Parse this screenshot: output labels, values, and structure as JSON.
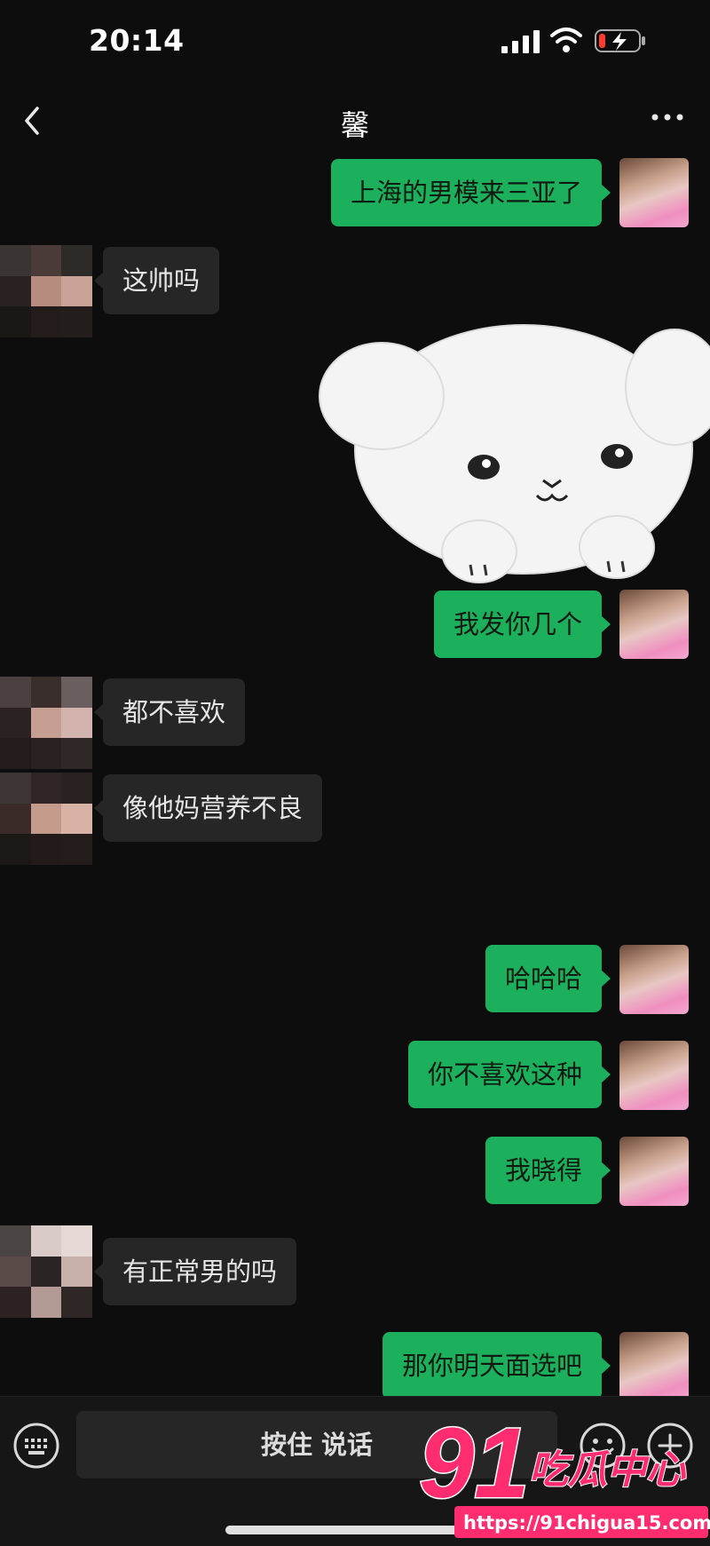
{
  "status_bar": {
    "time": "20:14"
  },
  "header": {
    "title": "馨"
  },
  "messages": [
    {
      "side": "right",
      "text": "上海的男模来三亚了"
    },
    {
      "side": "left",
      "text": "这帅吗"
    },
    {
      "side": "right",
      "type": "sticker",
      "sticker": "fluffy-white-puppy"
    },
    {
      "side": "right",
      "text": "我发你几个"
    },
    {
      "side": "left",
      "text": "都不喜欢"
    },
    {
      "side": "left",
      "text": "像他妈营养不良"
    },
    {
      "side": "right",
      "text": "哈哈哈"
    },
    {
      "side": "right",
      "text": "你不喜欢这种"
    },
    {
      "side": "right",
      "text": "我晓得"
    },
    {
      "side": "left",
      "text": "有正常男的吗"
    },
    {
      "side": "right",
      "text": "那你明天面选吧"
    }
  ],
  "input_bar": {
    "voice_label": "按住 说话"
  },
  "watermark": {
    "brand_number": "91",
    "brand_name": "吃瓜中心",
    "url": "https://91chigua15.com"
  },
  "colors": {
    "bubble_me": "#1db05c",
    "bubble_other": "#262626",
    "background": "#0d0d0d",
    "watermark": "#ff2d6f"
  },
  "icons": [
    "back-icon",
    "more-icon",
    "keyboard-icon",
    "emoji-icon",
    "plus-icon",
    "signal-icon",
    "wifi-icon",
    "battery-icon"
  ]
}
